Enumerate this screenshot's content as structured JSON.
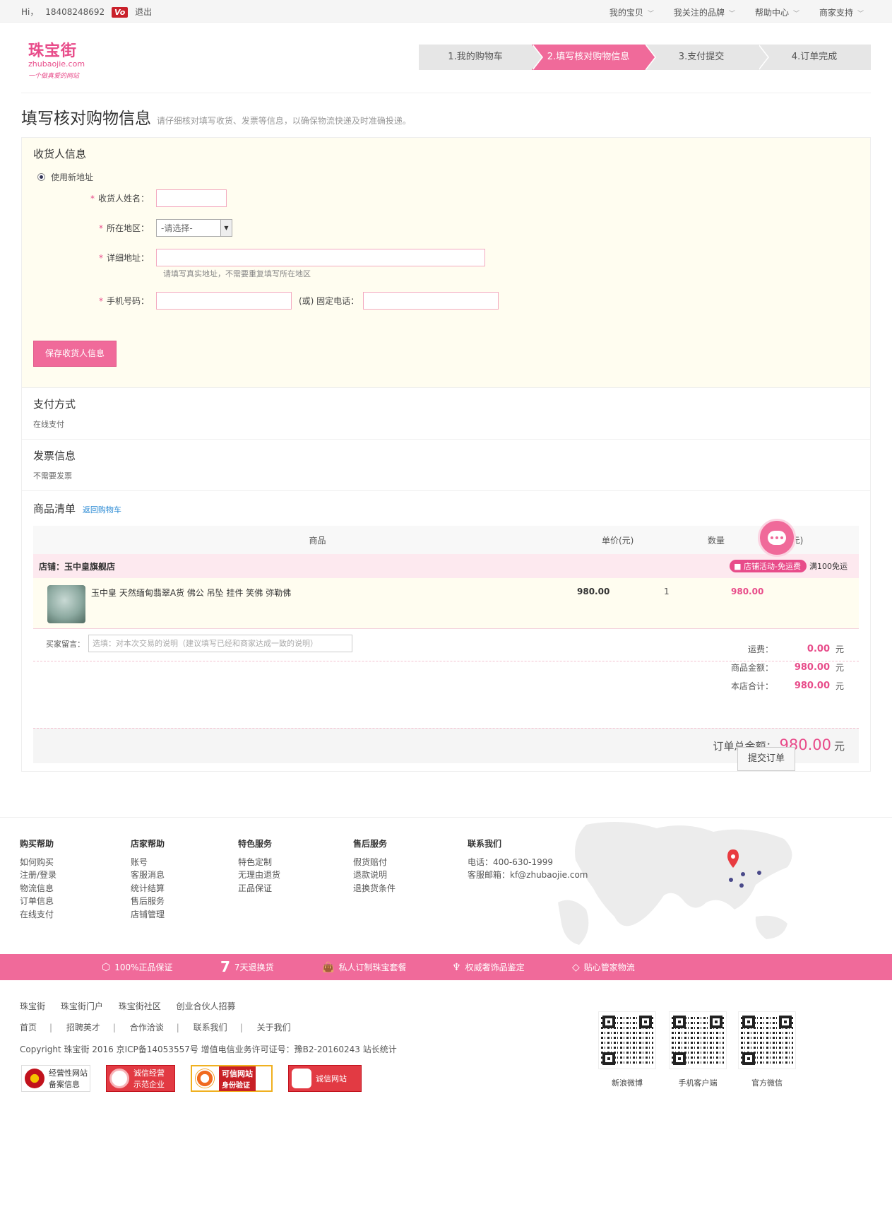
{
  "topbar": {
    "greeting": "Hi，",
    "phone": "18408248692",
    "vip_badge": "Vo",
    "logout": "退出",
    "menu": [
      {
        "label": "我的宝贝"
      },
      {
        "label": "我关注的品牌"
      },
      {
        "label": "帮助中心"
      },
      {
        "label": "商家支持"
      }
    ]
  },
  "logo": {
    "cn": "珠宝街",
    "en": "zhubaojie.com",
    "slogan": "一个做真爱的网站"
  },
  "steps": [
    {
      "label": "1.我的购物车",
      "active": false
    },
    {
      "label": "2.填写核对购物信息",
      "active": true
    },
    {
      "label": "3.支付提交",
      "active": false
    },
    {
      "label": "4.订单完成",
      "active": false
    }
  ],
  "page": {
    "title": "填写核对购物信息",
    "desc": "请仔细核对填写收货、发票等信息，以确保物流快递及时准确投递。"
  },
  "consignee": {
    "title": "收货人信息",
    "use_new_address": "使用新地址",
    "name_label": "收货人姓名：",
    "region_label": "所在地区：",
    "region_placeholder": "-请选择-",
    "address_label": "详细地址：",
    "address_hint": "请填写真实地址，不需要重复填写所在地区",
    "mobile_label": "手机号码：",
    "tel_label": "(或) 固定电话：",
    "required_mark": "*",
    "save_button": "保存收货人信息"
  },
  "payment": {
    "title": "支付方式",
    "value": "在线支付"
  },
  "invoice": {
    "title": "发票信息",
    "value": "不需要发票"
  },
  "goods": {
    "title": "商品清单",
    "back_link": "返回购物车",
    "columns": [
      "商品",
      "单价(元)",
      "数量",
      "小计(元)"
    ],
    "store": "店铺：玉中皇旗舰店",
    "promo_tag": "店铺活动-免运费",
    "promo_text": "满100免运",
    "item": {
      "title": "玉中皇 天然缅甸翡翠A货 佛公 吊坠 挂件 笑佛 弥勒佛",
      "price": "980.00",
      "qty": "1",
      "subtotal": "980.00"
    },
    "note_label": "买家留言：",
    "note_placeholder": "选填：对本次交易的说明（建议填写已经和商家达成一致的说明）",
    "summary": [
      {
        "label": "运费：",
        "value": "0.00",
        "unit": "元"
      },
      {
        "label": "商品金额：",
        "value": "980.00",
        "unit": "元"
      },
      {
        "label": "本店合计：",
        "value": "980.00",
        "unit": "元"
      }
    ],
    "total_label": "订单总金额：",
    "total_value": "980.00",
    "total_unit": "元"
  },
  "submit_button": "提交订单",
  "footer": {
    "columns": [
      {
        "title": "购买帮助",
        "items": [
          "如何购买",
          "注册/登录",
          "物流信息",
          "订单信息",
          "在线支付"
        ]
      },
      {
        "title": "店家帮助",
        "items": [
          "账号",
          "客服消息",
          "统计结算",
          "售后服务",
          "店铺管理"
        ]
      },
      {
        "title": "特色服务",
        "items": [
          "特色定制",
          "无理由退货",
          "正品保证"
        ]
      },
      {
        "title": "售后服务",
        "items": [
          "假货赔付",
          "退款说明",
          "退换货条件"
        ]
      },
      {
        "title": "联系我们",
        "items": [
          "电话：400-630-1999",
          "客服邮箱：kf@zhubaojie.com"
        ]
      }
    ],
    "guarantees": [
      {
        "icon": "genuine-icon",
        "label": "100%正品保证"
      },
      {
        "icon": "seven-day-icon",
        "glyph": "7",
        "label": "7天退换货"
      },
      {
        "icon": "bag-icon",
        "label": "私人订制珠宝套餐"
      },
      {
        "icon": "microscope-icon",
        "label": "权威奢饰品鉴定"
      },
      {
        "icon": "diamond-icon",
        "label": "贴心管家物流"
      }
    ],
    "links_row1": [
      "珠宝街",
      "珠宝街门户",
      "珠宝街社区",
      "创业合伙人招募"
    ],
    "links_row2": [
      "首页",
      "招聘英才",
      "合作洽谈",
      "联系我们",
      "关于我们"
    ],
    "separator": "|",
    "copyright": "Copyright 珠宝街 2016 京ICP备14053557号 增值电信业务许可证号：豫B2-20160243  站长统计",
    "badges": [
      {
        "line1": "经营性网站",
        "line2": "备案信息"
      },
      {
        "line1": "诚信经营",
        "line2": "示范企业"
      },
      {
        "line1": "可信网站",
        "line2": "身份验证"
      },
      {
        "line1": "诚信网站",
        "line2": ""
      }
    ],
    "qrcodes": [
      {
        "label": "新浪微博"
      },
      {
        "label": "手机客户端"
      },
      {
        "label": "官方微信"
      }
    ]
  },
  "colors": {
    "brand_pink": "#f06a9a",
    "price_pink": "#e84c8a",
    "form_bg": "#fffdf0"
  }
}
